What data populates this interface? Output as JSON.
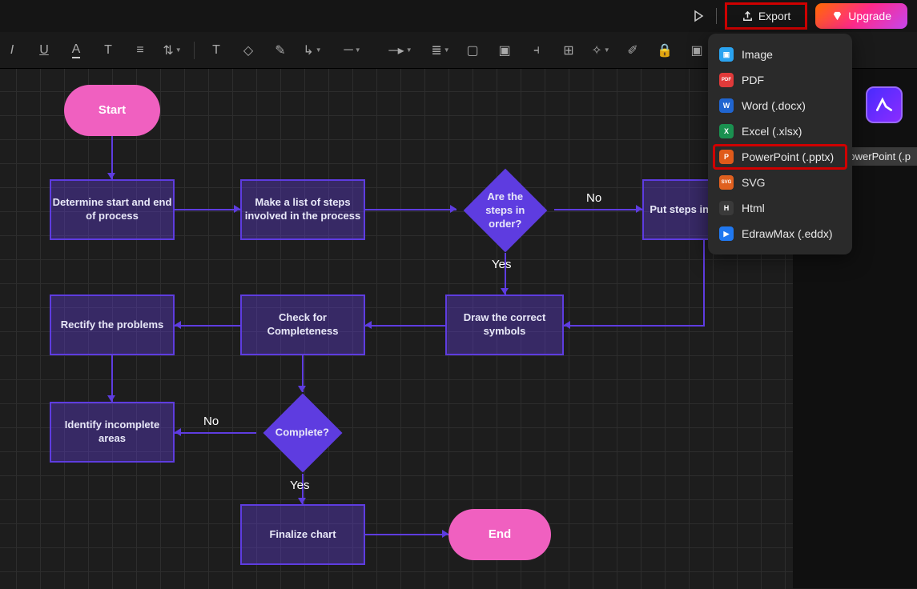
{
  "topbar": {
    "export_label": "Export",
    "upgrade_label": "Upgrade"
  },
  "export_menu": {
    "items": [
      {
        "icon": "fi-img",
        "tag": "▣",
        "label": "Image"
      },
      {
        "icon": "fi-pdf",
        "tag": "PDF",
        "label": "PDF"
      },
      {
        "icon": "fi-word",
        "tag": "W",
        "label": "Word (.docx)"
      },
      {
        "icon": "fi-excel",
        "tag": "X",
        "label": "Excel (.xlsx)"
      },
      {
        "icon": "fi-ppt",
        "tag": "P",
        "label": "PowerPoint (.pptx)"
      },
      {
        "icon": "fi-svg",
        "tag": "SVG",
        "label": "SVG"
      },
      {
        "icon": "fi-html",
        "tag": "H",
        "label": "Html"
      },
      {
        "icon": "fi-eddx",
        "tag": "▶",
        "label": "EdrawMax (.eddx)"
      }
    ]
  },
  "tooltip": "PowerPoint (.p",
  "flow": {
    "start": "Start",
    "determine": "Determine start and end of process",
    "makelist": "Make a list of steps involved in the process",
    "inorder": "Are the steps in order?",
    "putsteps": "Put steps in sequence",
    "draw": "Draw the correct symbols",
    "check": "Check for Completeness",
    "rectify": "Rectify the problems",
    "identify": "Identify incomplete areas",
    "complete": "Complete?",
    "finalize": "Finalize chart",
    "end": "End",
    "yes1": "Yes",
    "no1": "No",
    "yes2": "Yes",
    "no2": "No"
  }
}
